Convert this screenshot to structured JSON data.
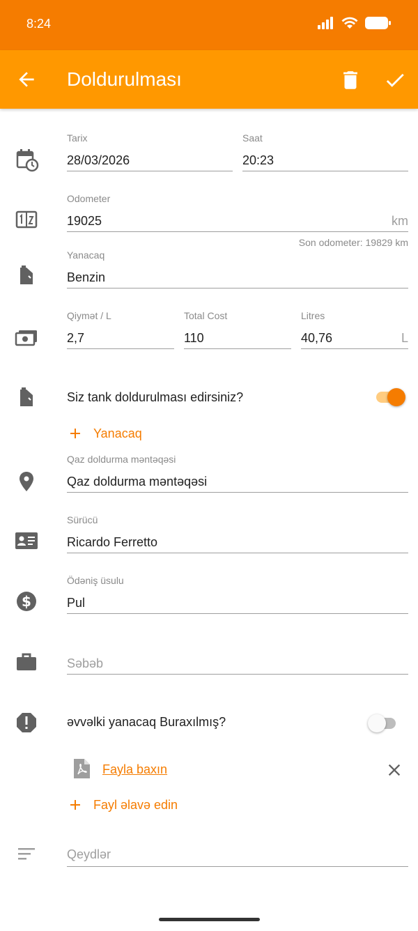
{
  "status_bar": {
    "time": "8:24",
    "icons": [
      "signal-icon",
      "wifi-icon",
      "battery-icon"
    ]
  },
  "app_bar": {
    "title": "Doldurulması",
    "actions": [
      "back-arrow-icon",
      "delete-icon",
      "check-icon"
    ]
  },
  "colors": {
    "primary": "#ff9800",
    "primary_dark": "#f57c00",
    "accent": "#f57c00",
    "label": "#8a8a8a",
    "line": "#9e9e9e"
  },
  "form": {
    "date": {
      "label": "Tarix",
      "value": "28/03/2026"
    },
    "time": {
      "label": "Saat",
      "value": "20:23"
    },
    "odometer": {
      "label": "Odometer",
      "value": "19025",
      "unit": "km",
      "helper": "Son odometer: 19829 km"
    },
    "fuel": {
      "label": "Yanacaq",
      "value": "Benzin"
    },
    "price": {
      "label": "Qiymət / L",
      "value": "2,7"
    },
    "total_cost": {
      "label": "Total Cost",
      "value": "110"
    },
    "litres": {
      "label": "Litres",
      "value": "40,76",
      "unit": "L"
    },
    "full_tank": {
      "label": "Siz tank doldurulması edirsiniz?",
      "checked": true
    },
    "add_fuel": {
      "label": "Yanacaq"
    },
    "station": {
      "label": "Qaz doldurma məntəqəsi",
      "value": "Qaz doldurma məntəqəsi"
    },
    "driver": {
      "label": "Sürücü",
      "value": "Ricardo Ferretto"
    },
    "payment": {
      "label": "Ödəniş üsulu",
      "value": "Pul"
    },
    "reason": {
      "placeholder": "Səbəb"
    },
    "missed_previous": {
      "label": "əvvəlki yanacaq Buraxılmış?",
      "checked": false
    },
    "attachment": {
      "link": "Fayla baxın"
    },
    "add_file": {
      "label": "Fayl əlavə edin"
    },
    "notes": {
      "placeholder": "Qeydlər"
    }
  }
}
